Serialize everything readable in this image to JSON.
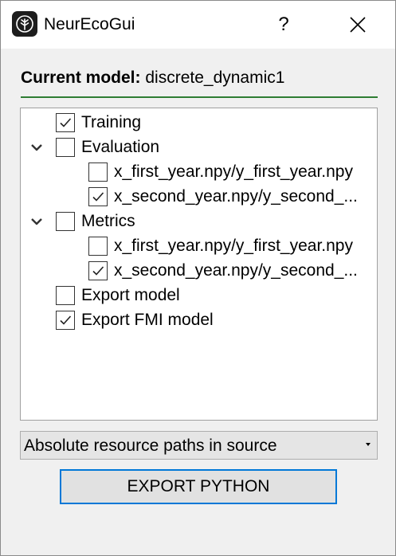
{
  "window": {
    "title": "NeurEcoGui",
    "help_label": "?"
  },
  "header": {
    "label": "Current model:",
    "model_name": "discrete_dynamic1"
  },
  "tree": [
    {
      "label": "Training",
      "checked": true,
      "level": 0,
      "expandable": false
    },
    {
      "label": "Evaluation",
      "checked": false,
      "level": 0,
      "expandable": true
    },
    {
      "label": "x_first_year.npy/y_first_year.npy",
      "checked": false,
      "level": 1,
      "expandable": false
    },
    {
      "label": "x_second_year.npy/y_second_...",
      "checked": true,
      "level": 1,
      "expandable": false
    },
    {
      "label": "Metrics",
      "checked": false,
      "level": 0,
      "expandable": true
    },
    {
      "label": "x_first_year.npy/y_first_year.npy",
      "checked": false,
      "level": 1,
      "expandable": false
    },
    {
      "label": "x_second_year.npy/y_second_...",
      "checked": true,
      "level": 1,
      "expandable": false
    },
    {
      "label": "Export model",
      "checked": false,
      "level": 0,
      "expandable": false
    },
    {
      "label": "Export FMI model",
      "checked": true,
      "level": 0,
      "expandable": false
    }
  ],
  "resource_paths": {
    "selected": "Absolute resource paths in source"
  },
  "export_button": {
    "label": "EXPORT PYTHON"
  },
  "colors": {
    "accent": "#0078d7",
    "rule": "#2e7d32"
  }
}
